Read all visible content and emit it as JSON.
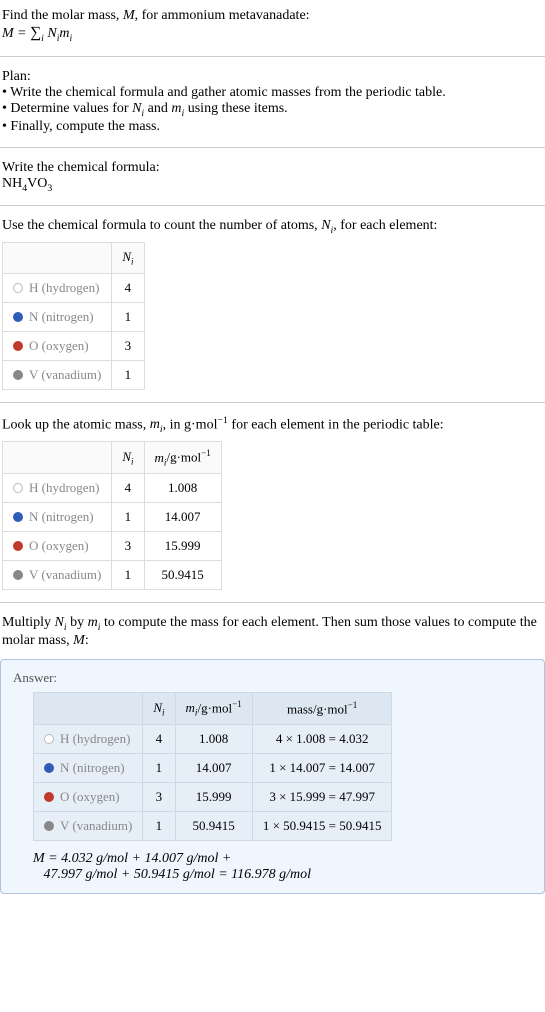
{
  "intro": {
    "line1_pre": "Find the molar mass, ",
    "line1_var": "M",
    "line1_post": ", for ammonium metavanadate:",
    "eq_left": "M",
    "eq_eq": " = ",
    "eq_sum": "∑",
    "eq_idx": "i",
    "eq_Ni": "N",
    "eq_Ni_sub": "i",
    "eq_mi": "m",
    "eq_mi_sub": "i"
  },
  "plan": {
    "heading": "Plan:",
    "b1": "• Write the chemical formula and gather atomic masses from the periodic table.",
    "b2_pre": "• Determine values for ",
    "b2_ni": "N",
    "b2_ni_sub": "i",
    "b2_and": " and ",
    "b2_mi": "m",
    "b2_mi_sub": "i",
    "b2_post": " using these items.",
    "b3": "• Finally, compute the mass."
  },
  "formula_section": {
    "heading": "Write the chemical formula:",
    "nh4vo3": "NH",
    "sub4": "4",
    "vo": "VO",
    "sub3": "3"
  },
  "count_section": {
    "text_pre": "Use the chemical formula to count the number of atoms, ",
    "ni": "N",
    "ni_sub": "i",
    "text_post": ", for each element:",
    "hdr_blank": "",
    "hdr_ni": "N",
    "hdr_ni_sub": "i",
    "rows": [
      {
        "dot": "dot-h",
        "label": "H (hydrogen)",
        "n": "4"
      },
      {
        "dot": "dot-n",
        "label": "N (nitrogen)",
        "n": "1"
      },
      {
        "dot": "dot-o",
        "label": "O (oxygen)",
        "n": "3"
      },
      {
        "dot": "dot-v",
        "label": "V (vanadium)",
        "n": "1"
      }
    ]
  },
  "mass_section": {
    "text_pre": "Look up the atomic mass, ",
    "mi": "m",
    "mi_sub": "i",
    "text_mid": ", in g·mol",
    "exp": "−1",
    "text_post": " for each element in the periodic table:",
    "hdr_ni": "N",
    "hdr_ni_sub": "i",
    "hdr_mi": "m",
    "hdr_mi_sub": "i",
    "hdr_mi_unit": "/g·mol",
    "hdr_mi_exp": "−1",
    "rows": [
      {
        "dot": "dot-h",
        "label": "H (hydrogen)",
        "n": "4",
        "m": "1.008"
      },
      {
        "dot": "dot-n",
        "label": "N (nitrogen)",
        "n": "1",
        "m": "14.007"
      },
      {
        "dot": "dot-o",
        "label": "O (oxygen)",
        "n": "3",
        "m": "15.999"
      },
      {
        "dot": "dot-v",
        "label": "V (vanadium)",
        "n": "1",
        "m": "50.9415"
      }
    ]
  },
  "multiply_section": {
    "text_pre": "Multiply ",
    "ni": "N",
    "ni_sub": "i",
    "by": " by ",
    "mi": "m",
    "mi_sub": "i",
    "text_mid": " to compute the mass for each element. Then sum those values to compute the molar mass, ",
    "M": "M",
    "text_post": ":"
  },
  "answer": {
    "label": "Answer:",
    "hdr_ni": "N",
    "hdr_ni_sub": "i",
    "hdr_mi": "m",
    "hdr_mi_sub": "i",
    "hdr_mi_unit": "/g·mol",
    "hdr_mi_exp": "−1",
    "hdr_mass": "mass/g·mol",
    "hdr_mass_exp": "−1",
    "rows": [
      {
        "dot": "dot-h",
        "label": "H (hydrogen)",
        "n": "4",
        "m": "1.008",
        "calc": "4 × 1.008 = 4.032"
      },
      {
        "dot": "dot-n",
        "label": "N (nitrogen)",
        "n": "1",
        "m": "14.007",
        "calc": "1 × 14.007 = 14.007"
      },
      {
        "dot": "dot-o",
        "label": "O (oxygen)",
        "n": "3",
        "m": "15.999",
        "calc": "3 × 15.999 = 47.997"
      },
      {
        "dot": "dot-v",
        "label": "V (vanadium)",
        "n": "1",
        "m": "50.9415",
        "calc": "1 × 50.9415 = 50.9415"
      }
    ],
    "final_M": "M",
    "final_eq1": " = 4.032 g/mol + 14.007 g/mol +",
    "final_eq2": "47.997 g/mol + 50.9415 g/mol = 116.978 g/mol"
  }
}
